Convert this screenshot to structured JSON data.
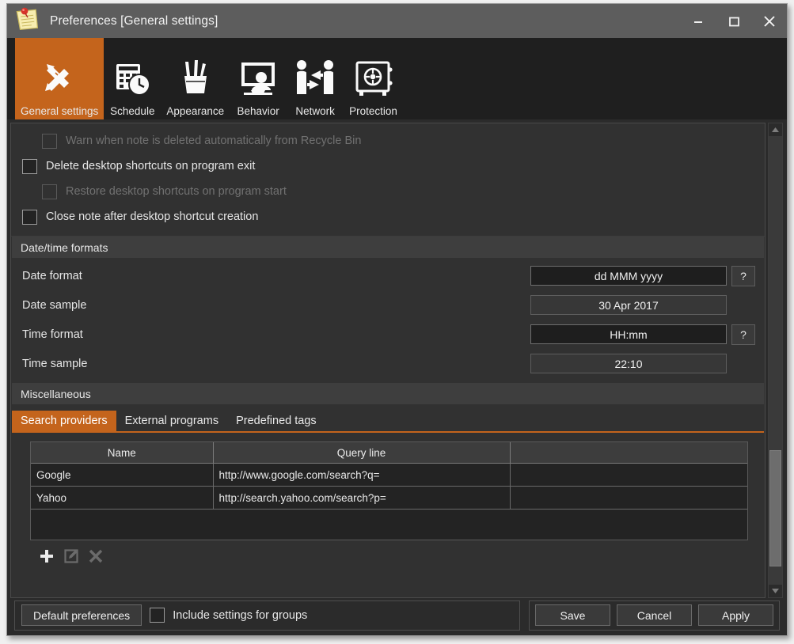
{
  "window": {
    "title": "Preferences [General settings]",
    "app_icon": "sticky-note-icon",
    "controls": {
      "minimize": "minimize-icon",
      "maximize": "maximize-icon",
      "close": "close-icon"
    }
  },
  "toolbar": {
    "items": [
      {
        "label": "General settings",
        "icon": "ruler-pencil-icon",
        "active": true
      },
      {
        "label": "Schedule",
        "icon": "calendar-clock-icon",
        "active": false
      },
      {
        "label": "Appearance",
        "icon": "pencil-cup-icon",
        "active": false
      },
      {
        "label": "Behavior",
        "icon": "monitor-user-icon",
        "active": false
      },
      {
        "label": "Network",
        "icon": "users-exchange-icon",
        "active": false
      },
      {
        "label": "Protection",
        "icon": "safe-lock-icon",
        "active": false
      }
    ]
  },
  "checkboxes": [
    {
      "label": "Warn when note is deleted automatically from Recycle Bin",
      "checked": false,
      "enabled": false,
      "indent": true
    },
    {
      "label": "Delete desktop shortcuts on program exit",
      "checked": false,
      "enabled": true,
      "indent": false
    },
    {
      "label": "Restore desktop shortcuts on program start",
      "checked": false,
      "enabled": false,
      "indent": true
    },
    {
      "label": "Close note after desktop shortcut creation",
      "checked": false,
      "enabled": true,
      "indent": false
    }
  ],
  "datetime": {
    "section_title": "Date/time formats",
    "rows": [
      {
        "label": "Date format",
        "value": "dd MMM yyyy",
        "editable": true,
        "help": "?"
      },
      {
        "label": "Date sample",
        "value": "30 Apr 2017",
        "editable": false,
        "help": ""
      },
      {
        "label": "Time format",
        "value": "HH:mm",
        "editable": true,
        "help": "?"
      },
      {
        "label": "Time sample",
        "value": "22:10",
        "editable": false,
        "help": ""
      }
    ]
  },
  "misc": {
    "section_title": "Miscellaneous",
    "tabs": [
      {
        "label": "Search providers",
        "active": true
      },
      {
        "label": "External programs",
        "active": false
      },
      {
        "label": "Predefined tags",
        "active": false
      }
    ],
    "table": {
      "columns": [
        "Name",
        "Query line",
        ""
      ],
      "rows": [
        [
          "Google",
          "http://www.google.com/search?q=",
          ""
        ],
        [
          "Yahoo",
          "http://search.yahoo.com/search?p=",
          ""
        ]
      ]
    },
    "actions": [
      {
        "icon": "plus-icon",
        "enabled": true
      },
      {
        "icon": "edit-icon",
        "enabled": false
      },
      {
        "icon": "delete-icon",
        "enabled": false
      }
    ]
  },
  "bottom": {
    "default_preferences_label": "Default preferences",
    "include_groups_label": "Include settings for groups",
    "include_groups_checked": false,
    "save_label": "Save",
    "cancel_label": "Cancel",
    "apply_label": "Apply"
  },
  "scrollbar": {
    "up_arrow": "chevron-up-icon",
    "down_arrow": "chevron-down-icon",
    "thumb_top_pct": 70,
    "thumb_height_pct": 26
  },
  "colors": {
    "accent": "#c4641c",
    "window_bg": "#2b2b2b",
    "panel_bg": "#313131",
    "titlebar_bg": "#5d5d5d"
  }
}
